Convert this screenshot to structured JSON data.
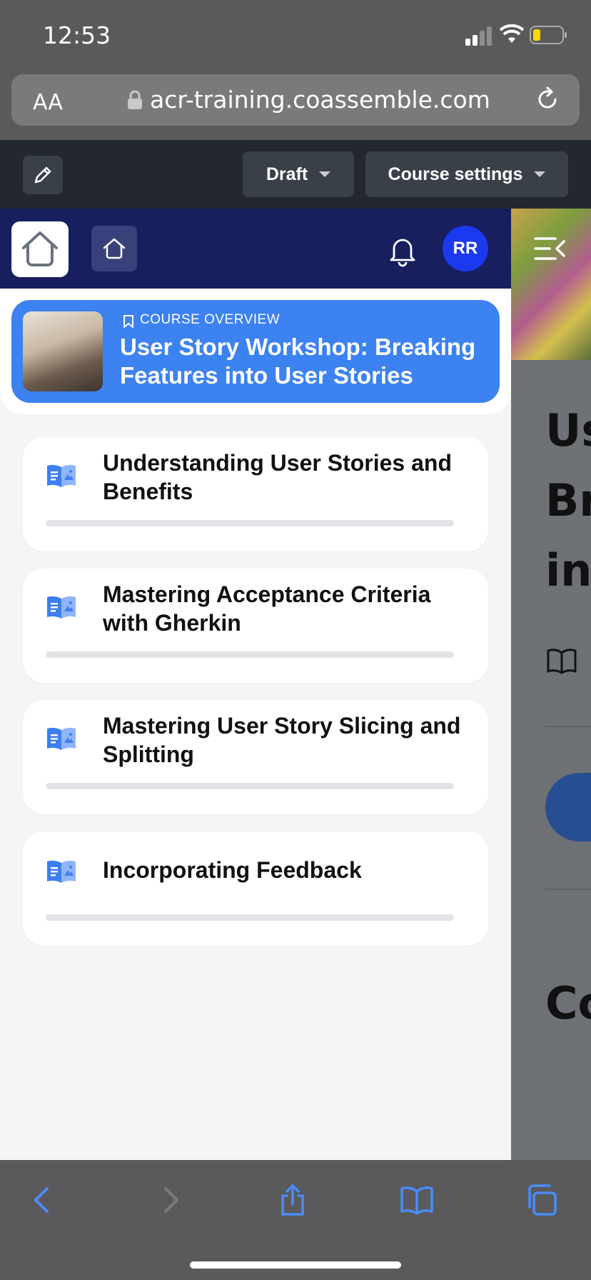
{
  "status_bar": {
    "time": "12:53",
    "battery_level": 0.2
  },
  "browser": {
    "text_size_label": "AA",
    "url": "acr-training.coassemble.com"
  },
  "toolbar": {
    "status_label": "Draft",
    "settings_label": "Course settings"
  },
  "header": {
    "avatar_initials": "RR"
  },
  "course": {
    "overview_label": "COURSE OVERVIEW",
    "title": "User Story Workshop: Breaking Features into User Stories"
  },
  "lessons": [
    {
      "title": "Understanding User Stories and Benefits",
      "progress": 0
    },
    {
      "title": "Mastering Acceptance Criteria with Gherkin",
      "progress": 0
    },
    {
      "title": "Mastering User Story Slicing and Splitting",
      "progress": 0
    },
    {
      "title": "Incorporating Feedback",
      "progress": 0
    }
  ],
  "peek": {
    "line1": "Us",
    "line2": "Br",
    "line3": "in",
    "line4": "Co"
  },
  "colors": {
    "header_navy": "#171f5e",
    "overview_blue": "#3c82f1",
    "avatar_blue": "#1b3af0",
    "toolbar_dark": "#232830"
  }
}
